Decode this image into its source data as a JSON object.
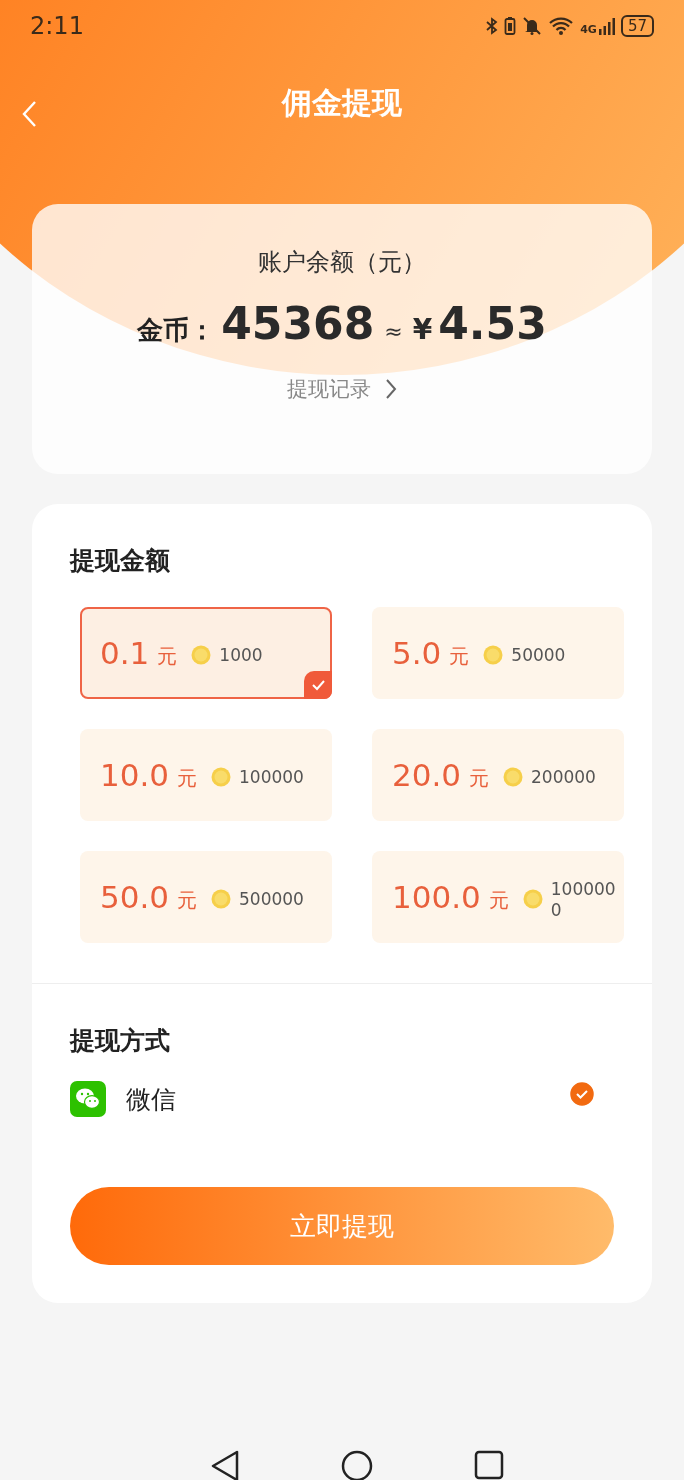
{
  "status_bar": {
    "time": "2:11",
    "network": "4G",
    "battery": "57"
  },
  "header": {
    "title": "佣金提现"
  },
  "balance": {
    "label": "账户余额（元）",
    "coin_label": "金币：",
    "coins": "45368",
    "approx": "≈",
    "currency": "¥",
    "amount": "4.53",
    "history_link": "提现记录"
  },
  "amount_section": {
    "title": "提现金额",
    "options": [
      {
        "amount": "0.1",
        "unit": "元",
        "coins": "1000",
        "selected": true
      },
      {
        "amount": "5.0",
        "unit": "元",
        "coins": "50000",
        "selected": false
      },
      {
        "amount": "10.0",
        "unit": "元",
        "coins": "100000",
        "selected": false
      },
      {
        "amount": "20.0",
        "unit": "元",
        "coins": "200000",
        "selected": false
      },
      {
        "amount": "50.0",
        "unit": "元",
        "coins": "500000",
        "selected": false
      },
      {
        "amount": "100.0",
        "unit": "元",
        "coins": "1000000",
        "selected": false
      }
    ]
  },
  "method_section": {
    "title": "提现方式",
    "methods": [
      {
        "name": "微信",
        "selected": true
      }
    ]
  },
  "submit_button": "立即提现"
}
